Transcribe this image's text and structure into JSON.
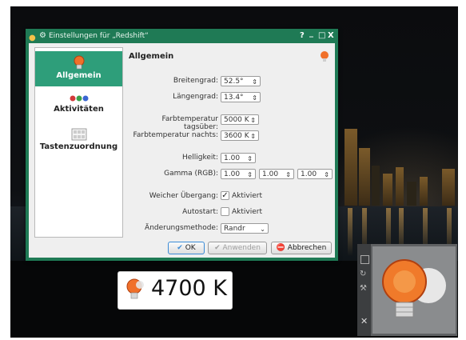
{
  "window": {
    "title": "Einstellungen für „Redshift“",
    "controls": {
      "help": "?",
      "minimize": "_",
      "maximize": "□",
      "close": "X"
    }
  },
  "sidebar": {
    "items": [
      {
        "label": "Allgemein",
        "icon": "redshift-bulb-icon",
        "active": true
      },
      {
        "label": "Aktivitäten",
        "icon": "activities-icon",
        "active": false
      },
      {
        "label": "Tastenzuordnung",
        "icon": "keyboard-icon",
        "active": false
      }
    ]
  },
  "general": {
    "heading": "Allgemein",
    "latitude_label": "Breitengrad:",
    "latitude_value": "52.5°",
    "longitude_label": "Längengrad:",
    "longitude_value": "13.4°",
    "day_temp_label": "Farbtemperatur tagsüber:",
    "day_temp_value": "5000 K",
    "night_temp_label": "Farbtemperatur nachts:",
    "night_temp_value": "3600 K",
    "brightness_label": "Helligkeit:",
    "brightness_value": "1.00",
    "gamma_label": "Gamma (RGB):",
    "gamma_r": "1.00",
    "gamma_g": "1.00",
    "gamma_b": "1.00",
    "smooth_label": "Weicher Übergang:",
    "smooth_value": "Aktiviert",
    "smooth_checked": true,
    "autostart_label": "Autostart:",
    "autostart_value": "Aktiviert",
    "autostart_checked": false,
    "method_label": "Änderungsmethode:",
    "method_value": "Randr"
  },
  "buttons": {
    "ok": "OK",
    "apply": "Anwenden",
    "cancel": "Abbrechen"
  },
  "osd": {
    "value": "4700 K"
  },
  "colors": {
    "titlebar": "#1f7a55",
    "selection": "#2e9e7a",
    "bulb": "#f0702a"
  }
}
